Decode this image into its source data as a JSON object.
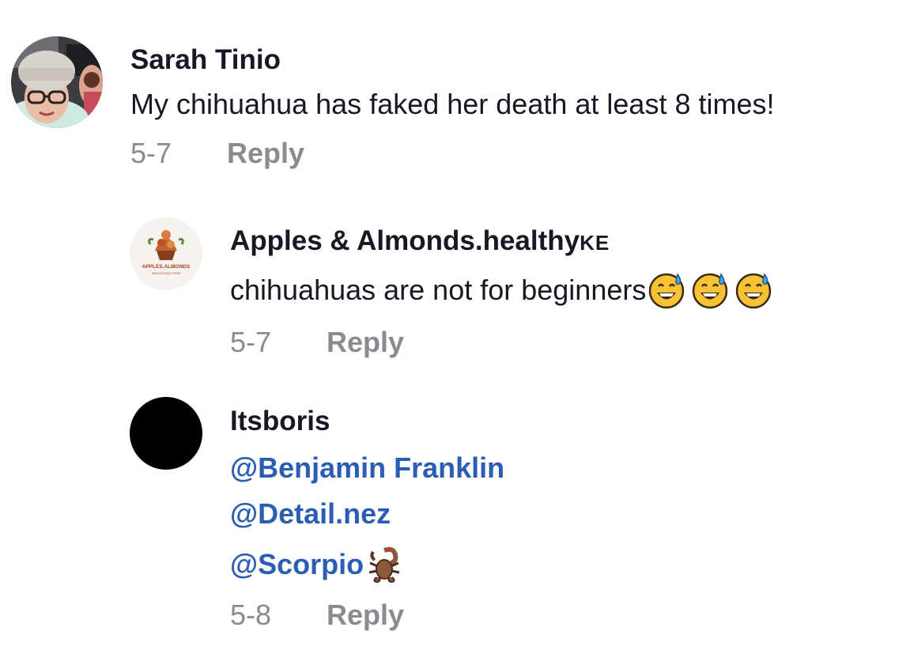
{
  "comments": [
    {
      "username": "Sarah Tinio",
      "text": "My chihuahua has faked her death at least 8 times!",
      "date": "5-7",
      "reply_label": "Reply"
    },
    {
      "username": "Apples & Almonds.healthy",
      "username_suffix": "KE",
      "text": "chihuahuas are not for beginners",
      "emojis": [
        "grinning-sweat-emoji",
        "grinning-sweat-emoji",
        "grinning-sweat-emoji"
      ],
      "date": "5-7",
      "reply_label": "Reply",
      "avatar_logo_text": "APPLES.ALMONDS",
      "avatar_logo_subtext": "HEALTHY.GUILT FREE"
    },
    {
      "username": "Itsboris",
      "mentions": [
        "@Benjamin Franklin",
        "@Detail.nez",
        "@Scorpio"
      ],
      "mention_emoji": "scorpion-emoji",
      "date": "5-8",
      "reply_label": "Reply"
    }
  ],
  "colors": {
    "text": "#161823",
    "meta": "#8a8b91",
    "mention": "#2b5db4",
    "background": "#ffffff"
  }
}
